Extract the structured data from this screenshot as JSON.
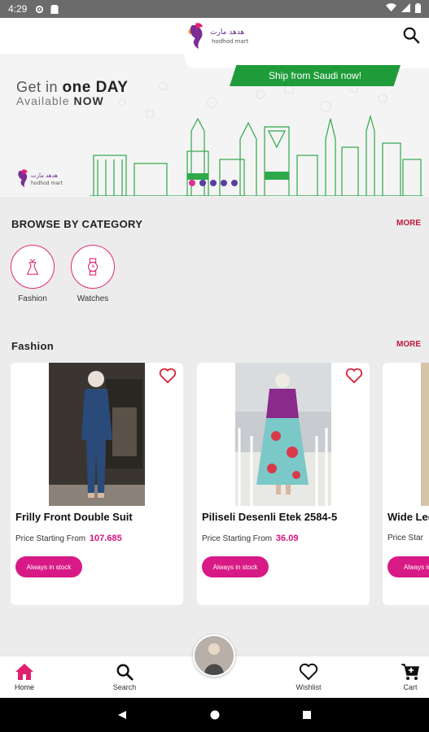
{
  "status_bar": {
    "time": "4:29"
  },
  "header": {
    "logo_arabic": "هدهد مارت",
    "logo_latin": "hodhod mart"
  },
  "banner": {
    "headline_prefix": "Get in ",
    "headline_bold": "one DAY",
    "subline_prefix": "Available ",
    "subline_bold": "NOW",
    "ship_tag": "Ship from Saudi now!",
    "slides": 5,
    "active_slide": 1
  },
  "browse": {
    "title": "BROWSE BY CATEGORY",
    "more": "MORE",
    "categories": [
      {
        "label": "Fashion",
        "icon": "dress-icon"
      },
      {
        "label": "Watches",
        "icon": "watch-icon"
      }
    ]
  },
  "fashion": {
    "title": "Fashion",
    "more": "MORE",
    "products": [
      {
        "name": "Frilly Front Double Suit",
        "price_label": "Price Starting From",
        "price": "107.685",
        "button": "Always in stock"
      },
      {
        "name": "Piliseli Desenli Etek 2584-5",
        "price_label": "Price Starting From",
        "price": "36.09",
        "button": "Always in stock"
      },
      {
        "name": "Wide Leg",
        "price_label": "Price Star",
        "price": "",
        "button": "Always in st"
      }
    ]
  },
  "bottom_nav": {
    "items": [
      {
        "label": "Home",
        "icon": "home-icon",
        "active": true
      },
      {
        "label": "Search",
        "icon": "search-icon",
        "active": false
      },
      {
        "label": "Wishlist",
        "icon": "heart-icon",
        "active": false
      },
      {
        "label": "Cart",
        "icon": "cart-icon",
        "active": false
      }
    ]
  },
  "colors": {
    "brand_pink": "#d81a86",
    "brand_green": "#1f9c3a",
    "more_red": "#c0183a"
  }
}
